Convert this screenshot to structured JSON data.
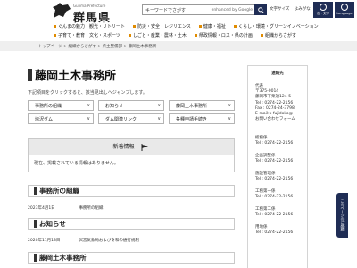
{
  "header": {
    "logo_en": "Gunma Prefecture",
    "logo_jp": "群馬県",
    "search_placeholder": "キーワードでさがす",
    "search_engine": "enhanced by Google",
    "links": [
      "文字サイズ",
      "よみがな",
      "PDF"
    ],
    "icon_boxes": [
      "色・文字",
      "Language"
    ]
  },
  "nav": {
    "row1": [
      "ぐんまの魅力・観光・リトリート",
      "防災・安全・レジリエンス",
      "健康・福祉",
      "くらし・環境・グリーンイノベーション"
    ],
    "row2": [
      "子育て・教育・文化・スポーツ",
      "しごと・産業・農林・土木",
      "県政情報・ロス・県の計画",
      "組織からさがす"
    ]
  },
  "breadcrumb": "トップページ > 組織からさがす > 県土整備部 > 藤岡土木事務所",
  "main": {
    "title": "藤岡土木事務所",
    "intro": "下記項目をクリックすると、該当見出しへジャンプします。",
    "links": [
      "事務所の組織",
      "お知らせ",
      "藤岡土木事務所",
      "塩沢ダム",
      "ダム関連リンク",
      "各種申請手続き"
    ],
    "chevron": "∨",
    "news": {
      "heading": "新着情報",
      "body": "現在、掲載されている情報はありません。"
    },
    "sections": [
      {
        "title": "事務所の組織",
        "date": "2023年4月1日",
        "text": "事務所の組織"
      },
      {
        "title": "お知らせ",
        "date": "2020年11月13日",
        "text": "冥宮気象局および令和の通行規制"
      },
      {
        "title": "藤岡土木事務所",
        "date": "",
        "text": ""
      }
    ]
  },
  "sidebar": {
    "title": "連絡先",
    "blocks": [
      [
        "代表",
        "〒375-0014",
        "藤岡市下栗須124-5",
        "Tel : 0274-22-2156",
        "Fax : 0274-24-3798",
        "E-mail:k-fujidoko@",
        "お問い合わせフォーム"
      ],
      [
        "総務係",
        "Tel : 0274-22-2156"
      ],
      [
        "企画調整係",
        "Tel : 0274-22-2156"
      ],
      [
        "施設管理係",
        "Tel : 0274-22-2156"
      ],
      [
        "工務第一係",
        "Tel : 0274-22-2156"
      ],
      [
        "工務第二係",
        "Tel : 0274-22-2156"
      ],
      [
        "用地係",
        "Tel : 0274-22-2156"
      ]
    ]
  },
  "feedback_tab": "このページのご感想",
  "colors": {
    "navy": "#1f2d55",
    "accent": "#e08b00",
    "panel": "#e9e9e9"
  }
}
